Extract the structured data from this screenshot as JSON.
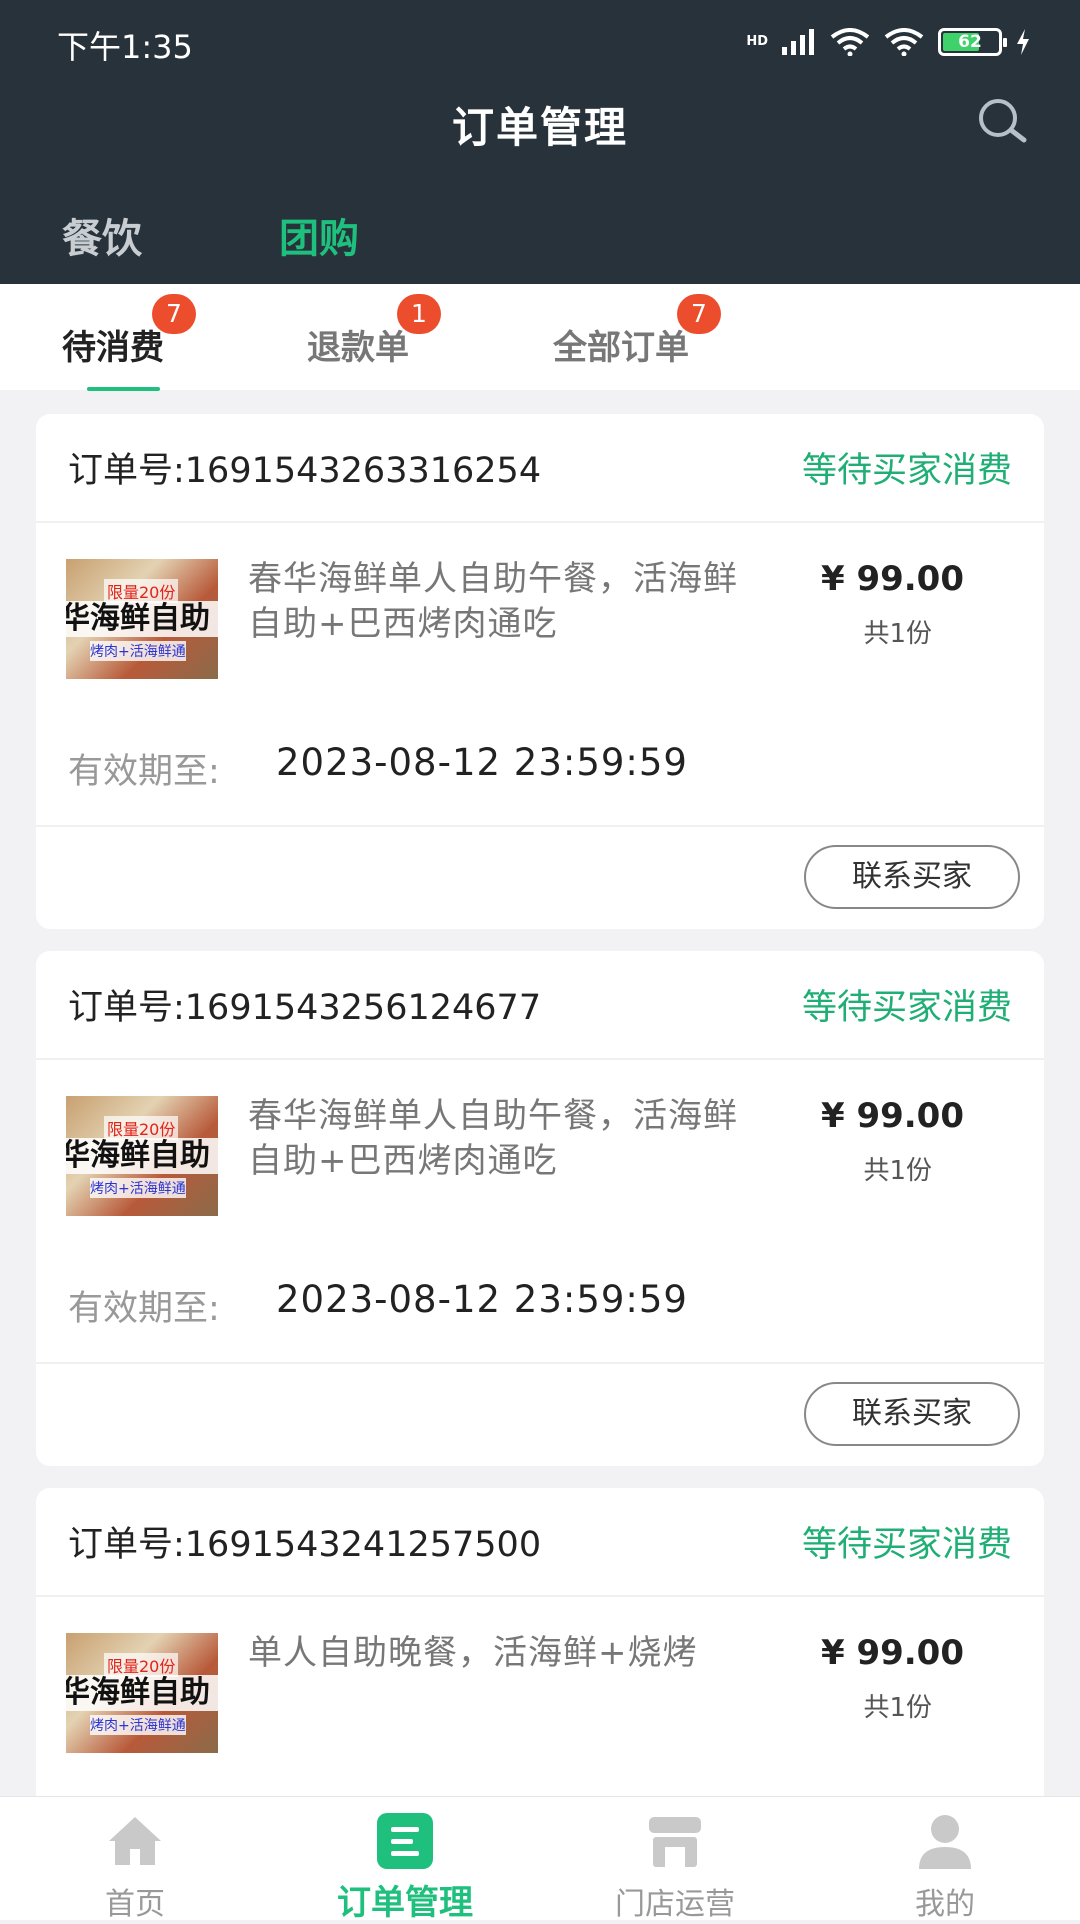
{
  "status_bar": {
    "time": "下午1:35",
    "hd": "HD",
    "battery": "62"
  },
  "header": {
    "title": "订单管理",
    "search_icon": "search-icon"
  },
  "category_tabs": [
    {
      "label": "餐饮",
      "active": false
    },
    {
      "label": "团购",
      "active": true
    }
  ],
  "sub_tabs": [
    {
      "label": "待消费",
      "badge": "7",
      "active": true
    },
    {
      "label": "退款单",
      "badge": "1",
      "active": false
    },
    {
      "label": "全部订单",
      "badge": "7",
      "active": false
    }
  ],
  "orders": [
    {
      "order_no": "订单号:1691543263316254",
      "status": "等待买家消费",
      "thumb": {
        "top": "限量20份",
        "mid": "华海鲜自助",
        "bottom": "烤肉+活海鲜通"
      },
      "product": "春华海鲜单人自助午餐，活海鲜自助+巴西烤肉通吃",
      "price": "¥ 99.00",
      "qty": "共1份",
      "valid_label": "有效期至:",
      "valid_date": "2023-08-12 23:59:59",
      "contact": "联系买家"
    },
    {
      "order_no": "订单号:1691543256124677",
      "status": "等待买家消费",
      "thumb": {
        "top": "限量20份",
        "mid": "华海鲜自助",
        "bottom": "烤肉+活海鲜通"
      },
      "product": "春华海鲜单人自助午餐，活海鲜自助+巴西烤肉通吃",
      "price": "¥ 99.00",
      "qty": "共1份",
      "valid_label": "有效期至:",
      "valid_date": "2023-08-12 23:59:59",
      "contact": "联系买家"
    },
    {
      "order_no": "订单号:1691543241257500",
      "status": "等待买家消费",
      "thumb": {
        "top": "限量20份",
        "mid": "华海鲜自助",
        "bottom": "烤肉+活海鲜通"
      },
      "product": "单人自助晚餐，活海鲜+烧烤",
      "price": "¥ 99.00",
      "qty": "共1份"
    }
  ],
  "bottom_nav": [
    {
      "label": "首页",
      "icon": "home-icon",
      "active": false
    },
    {
      "label": "订单管理",
      "icon": "order-icon",
      "active": true
    },
    {
      "label": "门店运营",
      "icon": "store-icon",
      "active": false
    },
    {
      "label": "我的",
      "icon": "profile-icon",
      "active": false
    }
  ],
  "colors": {
    "header_bg": "#27323a",
    "accent": "#1fbf7e",
    "badge": "#ec4d2c"
  }
}
